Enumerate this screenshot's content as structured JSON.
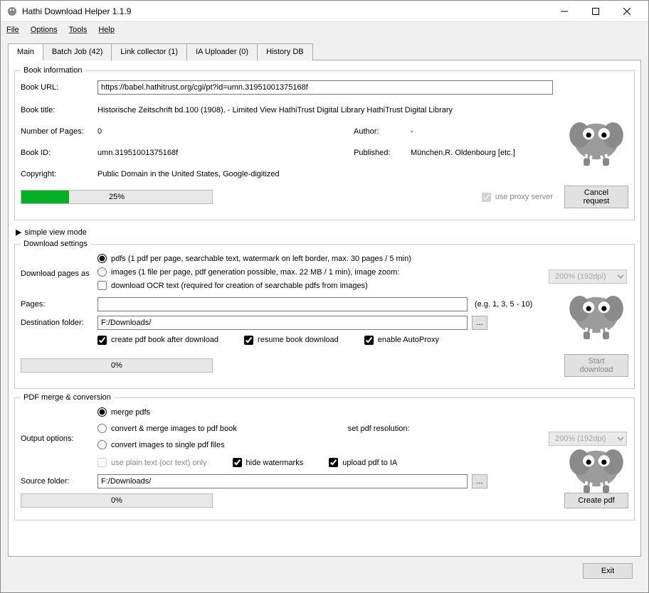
{
  "window": {
    "title": "Hathi Download Helper 1.1.9"
  },
  "menu": {
    "file": "File",
    "options": "Options",
    "tools": "Tools",
    "help": "Help"
  },
  "tabs": {
    "main": "Main",
    "batch": "Batch Job (42)",
    "link": "Link collector (1)",
    "ia": "IA Uploader (0)",
    "history": "History DB"
  },
  "bookinfo": {
    "legend": "Book information",
    "url_label": "Book URL:",
    "url_value": "https://babel.hathitrust.org/cgi/pt?id=umn.31951001375168f",
    "title_label": "Book title:",
    "title_value": "Historische Zeitschrift bd.100 (1908). - Limited View  HathiTrust Digital Library  HathiTrust Digital Library",
    "pages_label": "Number of Pages:",
    "pages_value": "0",
    "author_label": "Author:",
    "author_value": "-",
    "id_label": "Book ID:",
    "id_value": "umn.31951001375168f",
    "published_label": "Published:",
    "published_value": "München,R. Oldenbourg [etc.]",
    "copyright_label": "Copyright:",
    "copyright_value": "Public Domain in the United States, Google-digitized",
    "progress": "25%",
    "proxy": "use proxy server",
    "cancel": "Cancel request"
  },
  "simple": "simple view mode",
  "dl": {
    "legend": "Download settings",
    "label": "Download pages as",
    "pdfs": "pdfs (1 pdf per page, searchable text,  watermark on left border,  max. 30 pages / 5 min)",
    "images": "images (1 file per page, pdf generation possible, max. 22 MB / 1 min), image zoom:",
    "zoom": "200% (192dpi)",
    "ocr": "download OCR text (required for creation of searchable pdfs from images)",
    "pages_label": "Pages:",
    "pages_hint": "(e.g. 1, 3, 5 - 10)",
    "dest_label": "Destination folder:",
    "dest_value": "F:/Downloads/",
    "browse": "...",
    "create_pdf": "create pdf book after download",
    "resume": "resume book download",
    "autoproxy": "enable AutoProxy",
    "progress": "0%",
    "start": "Start download"
  },
  "pdf": {
    "legend": "PDF merge & conversion",
    "out_label": "Output options:",
    "merge": "merge pdfs",
    "convert_merge": "convert & merge images to pdf book",
    "convert_single": "convert images to single pdf files",
    "reso_label": "set pdf resolution:",
    "reso_value": "200% (192dpi)",
    "plain": "use plain text (ocr text) only",
    "hide": "hide watermarks",
    "upload": "upload pdf to IA",
    "src_label": "Source folder:",
    "src_value": "F:/Downloads/",
    "browse": "...",
    "progress": "0%",
    "create": "Create pdf"
  },
  "footer": {
    "exit": "Exit"
  }
}
